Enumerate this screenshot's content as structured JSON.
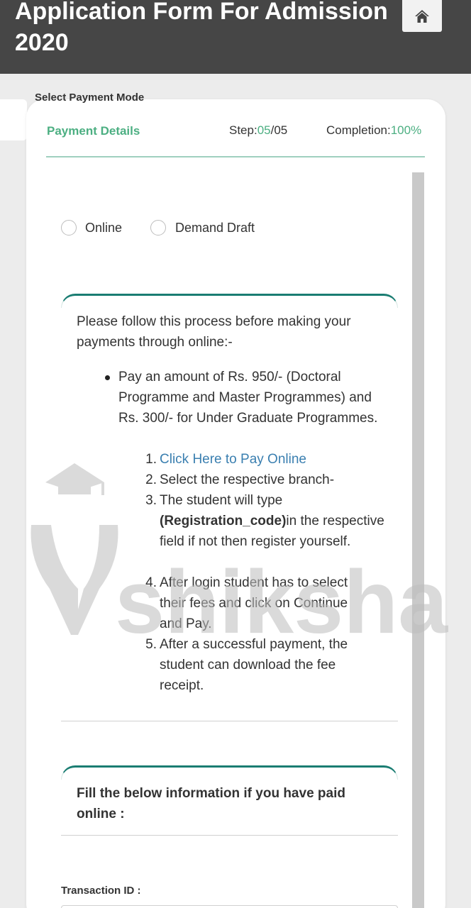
{
  "header": {
    "title": "Application Form For Admission 2020",
    "home_icon": "home-icon"
  },
  "form": {
    "section_title": "Payment Details",
    "step_label": "Step:",
    "step_value": "05",
    "step_total": "/05",
    "completion_label": "Completion:",
    "completion_value": "100%",
    "payment_mode_label": "Select Payment Mode",
    "payment_options": [
      "Online",
      "Demand Draft"
    ]
  },
  "instructions": {
    "intro": "Please follow this process before making your payments through online:-",
    "bullet": "Pay an amount of Rs. 950/-  (Doctoral Programme and Master Programmes) and Rs. 300/- for Under Graduate Programmes.",
    "steps": [
      "Click Here to Pay Online",
      "Select the respective branch-",
      "The student will type",
      "(Registration_code)",
      "in the respective field if not then register yourself.",
      "After login student has to select their fees and click on Continue and Pay.",
      "After a successful payment, the student can download the fee receipt."
    ]
  },
  "online_paid": {
    "heading": "Fill the below information if you have paid online :",
    "transaction_label": "Transaction ID :"
  },
  "watermark": {
    "text": "shiksha"
  },
  "colors": {
    "accent": "#4caf82",
    "topbar": "#464646",
    "link": "#3a7fb0",
    "teal": "#1a7d72"
  }
}
